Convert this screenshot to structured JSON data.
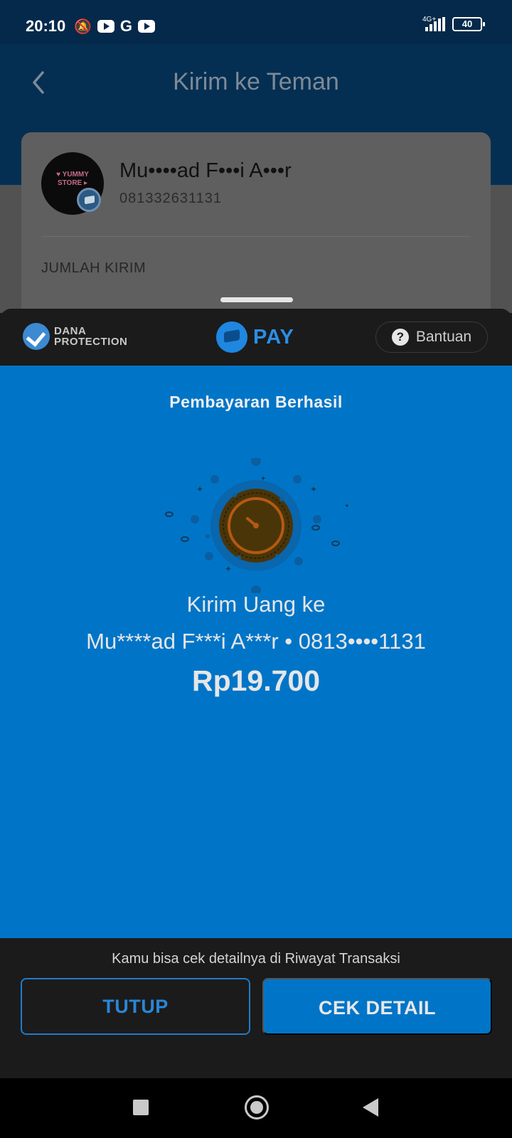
{
  "status_bar": {
    "time": "20:10",
    "network": "4G+",
    "battery": "40"
  },
  "header": {
    "title": "Kirim ke Teman"
  },
  "recipient": {
    "name": "Mu••••ad F•••i A•••r",
    "phone": "081332631131",
    "amount_label": "JUMLAH KIRIM"
  },
  "sheet": {
    "protection_line1": "DANA",
    "protection_line2": "PROTECTION",
    "pay_label": "PAY",
    "help_label": "Bantuan",
    "result_title": "Pembayaran Berhasil",
    "desc_line1": "Kirim Uang ke",
    "desc_line2": "Mu****ad F***i A***r • 0813••••1131",
    "amount": "Rp19.700",
    "footer_note": "Kamu bisa cek detailnya di Riwayat Transaksi",
    "close_label": "TUTUP",
    "detail_label": "CEK DETAIL"
  },
  "colors": {
    "accent_blue": "#0075c8",
    "dark_surface": "#1b1b1b",
    "dimmed_header": "#052f52"
  }
}
